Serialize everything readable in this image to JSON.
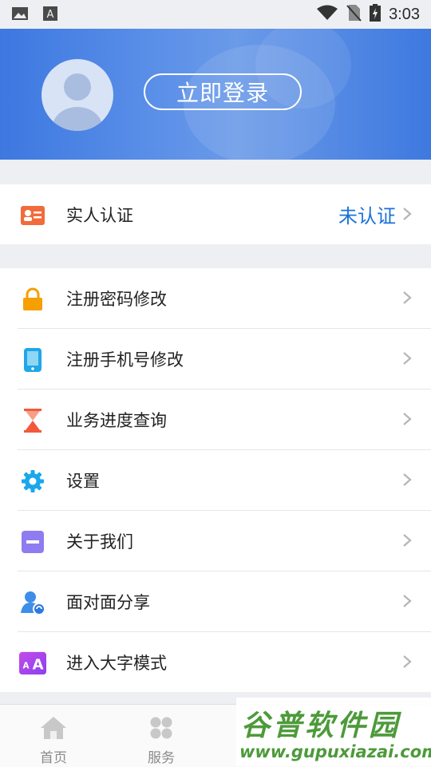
{
  "status": {
    "time": "3:03",
    "icons": [
      "image-icon",
      "a-icon",
      "wifi-icon",
      "no-sim-icon",
      "battery-charging-icon"
    ]
  },
  "header": {
    "login_label": "立即登录"
  },
  "verify": {
    "label": "实人认证",
    "value": "未认证"
  },
  "menu": [
    {
      "label": "注册密码修改",
      "icon": "lock-icon"
    },
    {
      "label": "注册手机号修改",
      "icon": "phone-icon"
    },
    {
      "label": "业务进度查询",
      "icon": "hourglass-icon"
    },
    {
      "label": "设置",
      "icon": "gear-icon"
    },
    {
      "label": "关于我们",
      "icon": "about-icon"
    },
    {
      "label": "面对面分享",
      "icon": "share-person-icon"
    },
    {
      "label": "进入大字模式",
      "icon": "large-font-icon"
    }
  ],
  "tabs": [
    {
      "label": "首页",
      "icon": "home-icon"
    },
    {
      "label": "服务",
      "icon": "grid-icon"
    }
  ],
  "watermark": {
    "title": "谷普软件园",
    "url": "www.gupuxiazai.com"
  },
  "colors": {
    "header_blue": "#3d78e0",
    "accent_blue": "#1a73d8",
    "watermark_green": "#4d9a3a"
  }
}
